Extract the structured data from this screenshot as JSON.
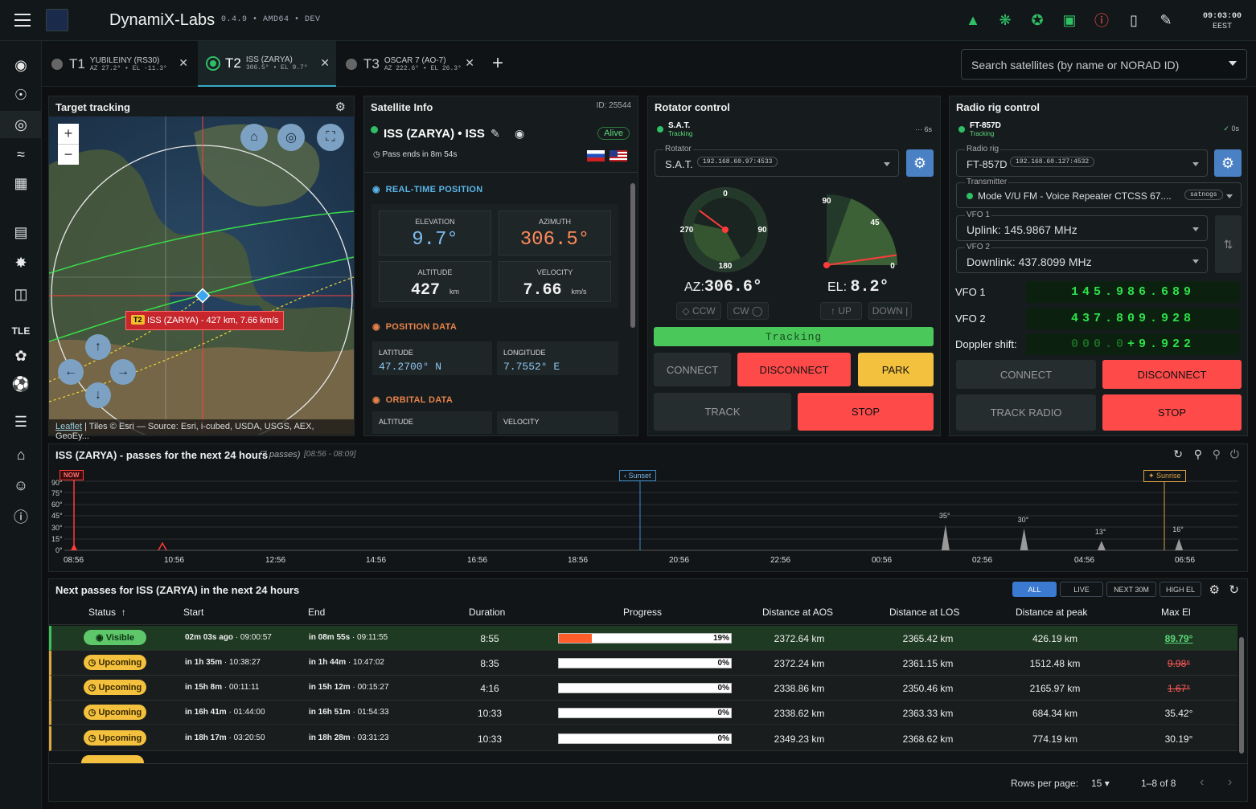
{
  "app": {
    "title": "DynamiX-Labs",
    "version": "0.4.9 • AMD64 • DEV",
    "clock_time": "09:03:00",
    "clock_tz": "EEST"
  },
  "tabs": [
    {
      "id": "T1",
      "name": "YUBILEINY (RS30)",
      "sub": "AZ 27.2° • EL -11.3°"
    },
    {
      "id": "T2",
      "name": "ISS (ZARYA)",
      "sub": "306.5° • EL 9.7°"
    },
    {
      "id": "T3",
      "name": "OSCAR 7 (AO-7)",
      "sub": "AZ 222.6° • EL 26.3°"
    }
  ],
  "search": {
    "placeholder": "Search satellites (by name or NORAD ID)"
  },
  "sidebar": {
    "tle_label": "TLE"
  },
  "target": {
    "title": "Target tracking",
    "label": "ISS (ZARYA) - 427 km, 7.66 km/s",
    "label_tag": "T2",
    "attribution_link": "Leaflet",
    "attribution": "| Tiles © Esri — Source: Esri, i-cubed, USDA, USGS, AEX, GeoEy..."
  },
  "satinfo": {
    "title": "Satellite Info",
    "id_label": "ID: 25544",
    "name": "ISS (ZARYA) • ISS",
    "status": "Alive",
    "pass_ends": "Pass ends in 8m 54s",
    "rt_header": "REAL-TIME POSITION",
    "elevation_label": "ELEVATION",
    "elevation": "9.7°",
    "azimuth_label": "AZIMUTH",
    "azimuth": "306.5°",
    "altitude_label": "ALTITUDE",
    "altitude": "427",
    "altitude_unit": "km",
    "velocity_label": "VELOCITY",
    "velocity": "7.66",
    "velocity_unit": "km/s",
    "pos_header": "POSITION DATA",
    "lat_label": "LATITUDE",
    "lat": "47.2700° N",
    "lon_label": "LONGITUDE",
    "lon": "7.7552° E",
    "orb_header": "ORBITAL DATA",
    "orb_alt_label": "ALTITUDE",
    "orb_vel_label": "VELOCITY"
  },
  "rotator": {
    "title": "Rotator control",
    "device": "S.A.T.",
    "device_status": "Tracking",
    "age": "··· 6s",
    "field_label": "Rotator",
    "field_value": "S.A.T.",
    "field_chip": "192.168.60.97:4533",
    "az_label": "AZ:",
    "az_value": "306.6°",
    "el_label": "EL:",
    "el_value": "8.2°",
    "az_ticks": {
      "n": "0",
      "e": "90",
      "s": "180",
      "w": "270"
    },
    "el_ticks": {
      "top": "90",
      "mid": "45",
      "zero": "0"
    },
    "az_deg": 306.6,
    "el_deg": 8.2,
    "ccw": "CCW",
    "cw": "CW",
    "up": "UP",
    "down": "DOWN",
    "tracking_bar": "Tracking",
    "connect": "CONNECT",
    "disconnect": "DISCONNECT",
    "park": "PARK",
    "track": "TRACK",
    "stop": "STOP"
  },
  "radio": {
    "title": "Radio rig control",
    "device": "FT-857D",
    "device_status": "Tracking",
    "age": "0s",
    "rig_label": "Radio rig",
    "rig_value": "FT-857D",
    "rig_chip": "192.168.60.127:4532",
    "tx_label": "Transmitter",
    "tx_value": "Mode V/U FM - Voice Repeater CTCSS 67....",
    "tx_chip": "satnogs",
    "vfo1_label": "VFO 1",
    "vfo1_value": "Uplink: 145.9867 MHz",
    "vfo2_label": "VFO 2",
    "vfo2_value": "Downlink: 437.8099 MHz",
    "lcd1_label": "VFO 1",
    "lcd1": "145.986.689",
    "lcd2_label": "VFO 2",
    "lcd2": "437.809.928",
    "lcd3_label": "Doppler shift:",
    "lcd3_dim": "000.0",
    "lcd3": "+9.922",
    "connect": "CONNECT",
    "disconnect": "DISCONNECT",
    "track": "TRACK RADIO",
    "stop": "STOP"
  },
  "timeline": {
    "title": "ISS (ZARYA) - passes for the next 24 hours",
    "count": "(7 passes)",
    "range": "[08:56 - 08:09]",
    "now": "NOW",
    "sunset": "Sunset",
    "sunrise": "Sunrise",
    "y_ticks": [
      "90°",
      "75°",
      "60°",
      "45°",
      "30°",
      "15°",
      "0°"
    ],
    "x_ticks": [
      "08:56",
      "10:56",
      "12:56",
      "14:56",
      "16:56",
      "18:56",
      "20:56",
      "22:56",
      "00:56",
      "02:56",
      "04:56",
      "06:56"
    ],
    "peaks": [
      {
        "label": "35°",
        "pos": 0.785,
        "el": 35
      },
      {
        "label": "30°",
        "pos": 0.855,
        "el": 30
      },
      {
        "label": "13°",
        "pos": 0.924,
        "el": 13
      },
      {
        "label": "16°",
        "pos": 0.993,
        "el": 16
      }
    ]
  },
  "passes": {
    "title": "Next passes for ISS (ZARYA) in the next 24 hours",
    "filters": [
      "ALL",
      "LIVE",
      "NEXT 30M",
      "HIGH EL"
    ],
    "headers": [
      "Status",
      "Start",
      "End",
      "Duration",
      "Progress",
      "Distance at AOS",
      "Distance at LOS",
      "Distance at peak",
      "Max El"
    ],
    "rows": [
      {
        "status": "Visible",
        "start_b": "02m 03s ago",
        "start": " · 09:00:57",
        "end_b": "in 08m 55s",
        "end": " · 09:11:55",
        "duration": "8:55",
        "progress": 19,
        "progress_text": "19%",
        "aos": "2372.64 km",
        "los": "2365.42 km",
        "peak": "426.19 km",
        "maxel": "89.79°"
      },
      {
        "status": "Upcoming",
        "start_b": "in 1h 35m",
        "start": " · 10:38:27",
        "end_b": "in 1h 44m",
        "end": " · 10:47:02",
        "duration": "8:35",
        "progress": 0,
        "progress_text": "0%",
        "aos": "2372.24 km",
        "los": "2361.15 km",
        "peak": "1512.48 km",
        "maxel": "9.98°"
      },
      {
        "status": "Upcoming",
        "start_b": "in 15h 8m",
        "start": " · 00:11:11",
        "end_b": "in 15h 12m",
        "end": " · 00:15:27",
        "duration": "4:16",
        "progress": 0,
        "progress_text": "0%",
        "aos": "2338.86 km",
        "los": "2350.46 km",
        "peak": "2165.97 km",
        "maxel": "1.67°"
      },
      {
        "status": "Upcoming",
        "start_b": "in 16h 41m",
        "start": " · 01:44:00",
        "end_b": "in 16h 51m",
        "end": " · 01:54:33",
        "duration": "10:33",
        "progress": 0,
        "progress_text": "0%",
        "aos": "2338.62 km",
        "los": "2363.33 km",
        "peak": "684.34 km",
        "maxel": "35.42°"
      },
      {
        "status": "Upcoming",
        "start_b": "in 18h 17m",
        "start": " · 03:20:50",
        "end_b": "in 18h 28m",
        "end": " · 03:31:23",
        "duration": "10:33",
        "progress": 0,
        "progress_text": "0%",
        "aos": "2349.23 km",
        "los": "2368.62 km",
        "peak": "774.19 km",
        "maxel": "30.19°"
      }
    ],
    "rows_per_page_label": "Rows per page:",
    "rows_per_page": "15",
    "pagination": "1–8 of 8"
  },
  "colors": {
    "accent": "#38a9c5",
    "ok": "#2fbf64",
    "danger": "#ff4a4a",
    "warn": "#f3c13d",
    "lcd": "#2de24a"
  }
}
